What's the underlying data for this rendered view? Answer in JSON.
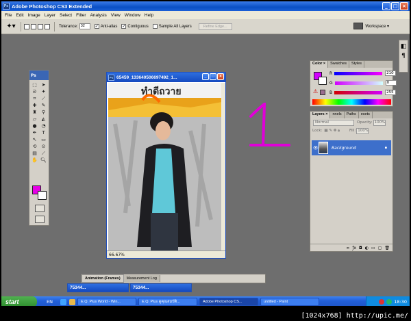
{
  "window": {
    "title": "Adobe Photoshop CS3 Extended",
    "icon_text": "Ps"
  },
  "menu": [
    "File",
    "Edit",
    "Image",
    "Layer",
    "Select",
    "Filter",
    "Analysis",
    "View",
    "Window",
    "Help"
  ],
  "options": {
    "tolerance_label": "Tolerance:",
    "tolerance_value": "32",
    "anti_alias_label": "Anti-alias",
    "anti_alias_checked": true,
    "contiguous_label": "Contiguous",
    "contiguous_checked": true,
    "sample_all_label": "Sample All Layers",
    "sample_all_checked": false,
    "refine_edge_label": "Refine Edge...",
    "workspace_label": "Workspace ▾"
  },
  "tools_palette": {
    "header": "Ps",
    "foreground": "#e600e6",
    "background": "#ffffff"
  },
  "document": {
    "title": "65459_133640506697492_1...",
    "zoom": "66.67%",
    "poster_text": "ทำดีถวาย"
  },
  "color_panel": {
    "tabs": [
      "Color ×",
      "Swatches",
      "Styles"
    ],
    "r_label": "R",
    "r_value": "210",
    "g_label": "G",
    "g_value": "0",
    "b_label": "B",
    "b_value": "255",
    "color": "#d200ff"
  },
  "layers_panel": {
    "tabs": [
      "Layers ×",
      "nnels",
      "Paths",
      "esets"
    ],
    "blend_mode": "Normal",
    "opacity_label": "Opacity:",
    "opacity_value": "100%",
    "lock_label": "Lock:",
    "fill_label": "Fill:",
    "fill_value": "100%",
    "layer_name": "Background"
  },
  "annotation": {
    "text": "1",
    "color": "#e000d8"
  },
  "animation_panel": {
    "tabs": [
      "Animation (Frames)",
      "Measurement Log"
    ]
  },
  "minimized": [
    {
      "title": "75344..."
    },
    {
      "title": "75344..."
    }
  ],
  "taskbar": {
    "start_label": "start",
    "language": "EN",
    "tasks": [
      {
        "label": "E.Q. Plus World - Win...",
        "active": false
      },
      {
        "label": "E.Q. Plus ดูคุณสมบัติ...",
        "active": false
      },
      {
        "label": "Adobe Photoshop CS...",
        "active": true
      },
      {
        "label": "untitled - Paint",
        "active": false
      }
    ],
    "clock": "18:30"
  },
  "watermark": "[1024x768] http://upic.me/"
}
